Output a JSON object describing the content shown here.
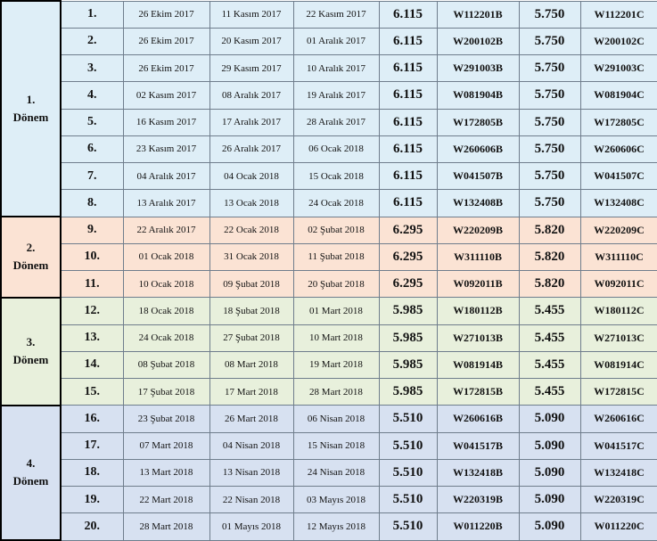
{
  "periods": [
    {
      "number": "1.",
      "label": "Dönem",
      "theme": "p1",
      "rows": [
        {
          "no": "1.",
          "d1": "26 Ekim 2017",
          "d2": "11 Kasım 2017",
          "d3": "22 Kasım 2017",
          "r1": "6.115",
          "c1": "W112201B",
          "r2": "5.750",
          "c2": "W112201C"
        },
        {
          "no": "2.",
          "d1": "26 Ekim 2017",
          "d2": "20 Kasım 2017",
          "d3": "01 Aralık 2017",
          "r1": "6.115",
          "c1": "W200102B",
          "r2": "5.750",
          "c2": "W200102C"
        },
        {
          "no": "3.",
          "d1": "26 Ekim 2017",
          "d2": "29 Kasım 2017",
          "d3": "10 Aralık 2017",
          "r1": "6.115",
          "c1": "W291003B",
          "r2": "5.750",
          "c2": "W291003C"
        },
        {
          "no": "4.",
          "d1": "02 Kasım 2017",
          "d2": "08 Aralık 2017",
          "d3": "19 Aralık 2017",
          "r1": "6.115",
          "c1": "W081904B",
          "r2": "5.750",
          "c2": "W081904C"
        },
        {
          "no": "5.",
          "d1": "16 Kasım 2017",
          "d2": "17 Aralık 2017",
          "d3": "28 Aralık 2017",
          "r1": "6.115",
          "c1": "W172805B",
          "r2": "5.750",
          "c2": "W172805C"
        },
        {
          "no": "6.",
          "d1": "23 Kasım 2017",
          "d2": "26 Aralık 2017",
          "d3": "06 Ocak 2018",
          "r1": "6.115",
          "c1": "W260606B",
          "r2": "5.750",
          "c2": "W260606C"
        },
        {
          "no": "7.",
          "d1": "04 Aralık 2017",
          "d2": "04 Ocak 2018",
          "d3": "15 Ocak 2018",
          "r1": "6.115",
          "c1": "W041507B",
          "r2": "5.750",
          "c2": "W041507C"
        },
        {
          "no": "8.",
          "d1": "13 Aralık 2017",
          "d2": "13 Ocak 2018",
          "d3": "24 Ocak 2018",
          "r1": "6.115",
          "c1": "W132408B",
          "r2": "5.750",
          "c2": "W132408C"
        }
      ]
    },
    {
      "number": "2.",
      "label": "Dönem",
      "theme": "p2",
      "rows": [
        {
          "no": "9.",
          "d1": "22 Aralık 2017",
          "d2": "22 Ocak 2018",
          "d3": "02 Şubat 2018",
          "r1": "6.295",
          "c1": "W220209B",
          "r2": "5.820",
          "c2": "W220209C"
        },
        {
          "no": "10.",
          "d1": "01 Ocak 2018",
          "d2": "31 Ocak 2018",
          "d3": "11 Şubat 2018",
          "r1": "6.295",
          "c1": "W311110B",
          "r2": "5.820",
          "c2": "W311110C"
        },
        {
          "no": "11.",
          "d1": "10 Ocak 2018",
          "d2": "09 Şubat 2018",
          "d3": "20 Şubat 2018",
          "r1": "6.295",
          "c1": "W092011B",
          "r2": "5.820",
          "c2": "W092011C"
        }
      ]
    },
    {
      "number": "3.",
      "label": "Dönem",
      "theme": "p3",
      "rows": [
        {
          "no": "12.",
          "d1": "18 Ocak 2018",
          "d2": "18 Şubat 2018",
          "d3": "01 Mart 2018",
          "r1": "5.985",
          "c1": "W180112B",
          "r2": "5.455",
          "c2": "W180112C"
        },
        {
          "no": "13.",
          "d1": "24 Ocak 2018",
          "d2": "27 Şubat 2018",
          "d3": "10 Mart 2018",
          "r1": "5.985",
          "c1": "W271013B",
          "r2": "5.455",
          "c2": "W271013C"
        },
        {
          "no": "14.",
          "d1": "08 Şubat 2018",
          "d2": "08 Mart 2018",
          "d3": "19 Mart 2018",
          "r1": "5.985",
          "c1": "W081914B",
          "r2": "5.455",
          "c2": "W081914C"
        },
        {
          "no": "15.",
          "d1": "17 Şubat 2018",
          "d2": "17 Mart 2018",
          "d3": "28 Mart 2018",
          "r1": "5.985",
          "c1": "W172815B",
          "r2": "5.455",
          "c2": "W172815C"
        }
      ]
    },
    {
      "number": "4.",
      "label": "Dönem",
      "theme": "p4",
      "rows": [
        {
          "no": "16.",
          "d1": "23 Şubat 2018",
          "d2": "26 Mart 2018",
          "d3": "06 Nisan 2018",
          "r1": "5.510",
          "c1": "W260616B",
          "r2": "5.090",
          "c2": "W260616C"
        },
        {
          "no": "17.",
          "d1": "07 Mart 2018",
          "d2": "04 Nisan 2018",
          "d3": "15 Nisan 2018",
          "r1": "5.510",
          "c1": "W041517B",
          "r2": "5.090",
          "c2": "W041517C"
        },
        {
          "no": "18.",
          "d1": "13 Mart 2018",
          "d2": "13 Nisan 2018",
          "d3": "24 Nisan 2018",
          "r1": "5.510",
          "c1": "W132418B",
          "r2": "5.090",
          "c2": "W132418C"
        },
        {
          "no": "19.",
          "d1": "22 Mart 2018",
          "d2": "22 Nisan 2018",
          "d3": "03 Mayıs 2018",
          "r1": "5.510",
          "c1": "W220319B",
          "r2": "5.090",
          "c2": "W220319C"
        },
        {
          "no": "20.",
          "d1": "28 Mart 2018",
          "d2": "01 Mayıs 2018",
          "d3": "12 Mayıs 2018",
          "r1": "5.510",
          "c1": "W011220B",
          "r2": "5.090",
          "c2": "W011220C"
        }
      ]
    }
  ]
}
